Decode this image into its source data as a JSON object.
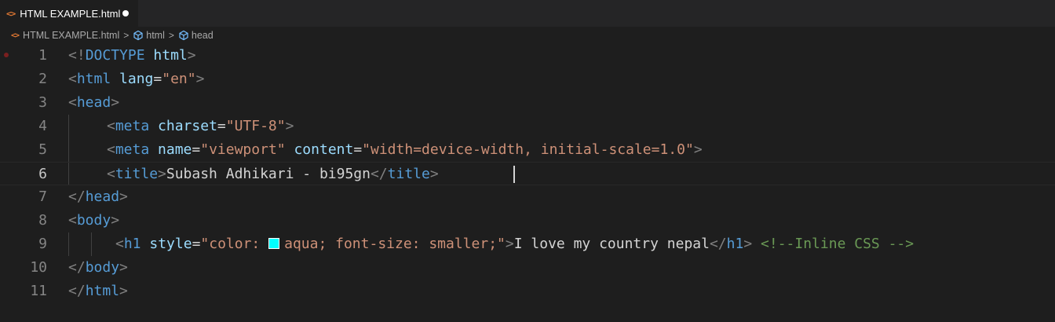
{
  "tab": {
    "icon": "<>",
    "label": "HTML EXAMPLE.html",
    "dirty_indicator": "unsaved-dot"
  },
  "breadcrumb": {
    "file_icon": "<>",
    "file": "HTML EXAMPLE.html",
    "sep": ">",
    "node1": "html",
    "node2": "head"
  },
  "colors": {
    "tag": "#569cd6",
    "attribute": "#9cdcfe",
    "string": "#ce9178",
    "bracket": "#808080",
    "comment": "#6a9955",
    "swatch": "#00ffff"
  },
  "editor": {
    "current_line": 6,
    "lines": [
      {
        "n": "1"
      },
      {
        "n": "2"
      },
      {
        "n": "3"
      },
      {
        "n": "4"
      },
      {
        "n": "5"
      },
      {
        "n": "6"
      },
      {
        "n": "7"
      },
      {
        "n": "8"
      },
      {
        "n": "9"
      },
      {
        "n": "10"
      },
      {
        "n": "11"
      }
    ]
  },
  "code": {
    "l1": {
      "open": "<!",
      "kw": "DOCTYPE",
      "sp": " ",
      "attr": "html",
      "close": ">"
    },
    "l2": {
      "open": "<",
      "tag": "html",
      "sp": " ",
      "attr": "lang",
      "eq": "=",
      "val": "\"en\"",
      "close": ">"
    },
    "l3": {
      "open": "<",
      "tag": "head",
      "close": ">"
    },
    "l4": {
      "open": "<",
      "tag": "meta",
      "sp": " ",
      "attr": "charset",
      "eq": "=",
      "val": "\"UTF-8\"",
      "close": ">"
    },
    "l5": {
      "open": "<",
      "tag": "meta",
      "sp1": " ",
      "attr1": "name",
      "eq1": "=",
      "val1": "\"viewport\"",
      "sp2": " ",
      "attr2": "content",
      "eq2": "=",
      "val2": "\"width=device-width, initial-scale=1.0\"",
      "close": ">"
    },
    "l6": {
      "open": "<",
      "tag": "title",
      "close": ">",
      "text": "Subash Adhikari - bi95gn",
      "open2": "</",
      "tag2": "title",
      "close2": ">"
    },
    "l7": {
      "open": "</",
      "tag": "head",
      "close": ">"
    },
    "l8": {
      "open": "<",
      "tag": "body",
      "close": ">"
    },
    "l9": {
      "open": "<",
      "tag": "h1",
      "sp": " ",
      "attr": "style",
      "eq": "=",
      "val_a": "\"color: ",
      "val_b": "aqua; font-size: smaller;\"",
      "close": ">",
      "text": "I love my country nepal",
      "open2": "</",
      "tag2": "h1",
      "close2": ">",
      "sp2": " ",
      "comment": "<!--Inline CSS -->"
    },
    "l10": {
      "open": "</",
      "tag": "body",
      "close": ">"
    },
    "l11": {
      "open": "</",
      "tag": "html",
      "close": ">"
    }
  }
}
